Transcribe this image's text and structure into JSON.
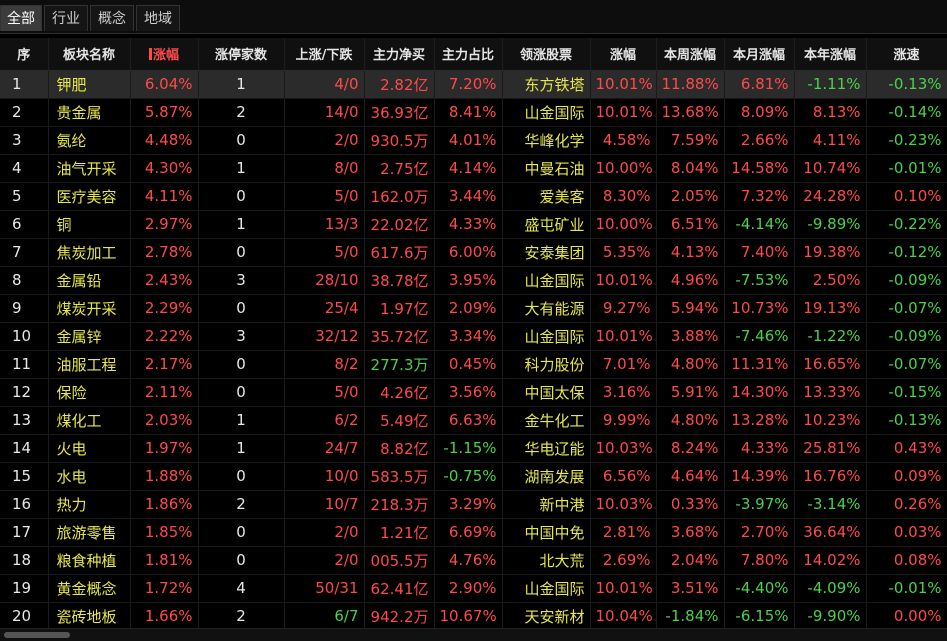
{
  "tabs": [
    {
      "label": "全部",
      "active": true
    },
    {
      "label": "行业",
      "active": false
    },
    {
      "label": "概念",
      "active": false
    },
    {
      "label": "地域",
      "active": false
    }
  ],
  "columns": {
    "index": "序",
    "name": "板块名称",
    "change": "涨幅",
    "limit_up": "涨停家数",
    "up_down": "上涨/下跌",
    "net_buy": "主力净买",
    "ratio": "主力占比",
    "leader": "领涨股票",
    "leader_change": "涨幅",
    "week_change": "本周涨幅",
    "month_change": "本月涨幅",
    "year_change": "本年涨幅",
    "speed": "涨速"
  },
  "colors": {
    "up": "#ff4a4a",
    "down": "#4ad24a",
    "name": "#e8e84a"
  },
  "rows": [
    {
      "idx": "1",
      "name": "钾肥",
      "change": "6.04%",
      "limit_up": "1",
      "up_down": "4/0",
      "net_buy": "2.82亿",
      "ratio": "7.20%",
      "leader": "东方铁塔",
      "leader_change": "10.01%",
      "week": "11.88%",
      "month": "6.81%",
      "year": "-1.11%",
      "speed": "-0.13%"
    },
    {
      "idx": "2",
      "name": "贵金属",
      "change": "5.87%",
      "limit_up": "2",
      "up_down": "14/0",
      "net_buy": "36.93亿",
      "ratio": "8.41%",
      "leader": "山金国际",
      "leader_change": "10.01%",
      "week": "13.68%",
      "month": "8.09%",
      "year": "8.13%",
      "speed": "-0.14%"
    },
    {
      "idx": "3",
      "name": "氨纶",
      "change": "4.48%",
      "limit_up": "0",
      "up_down": "2/0",
      "net_buy": "930.5万",
      "ratio": "4.01%",
      "leader": "华峰化学",
      "leader_change": "4.58%",
      "week": "7.59%",
      "month": "2.66%",
      "year": "4.11%",
      "speed": "-0.23%"
    },
    {
      "idx": "4",
      "name": "油气开采",
      "change": "4.30%",
      "limit_up": "1",
      "up_down": "8/0",
      "net_buy": "2.75亿",
      "ratio": "4.14%",
      "leader": "中曼石油",
      "leader_change": "10.00%",
      "week": "8.04%",
      "month": "14.58%",
      "year": "10.74%",
      "speed": "-0.01%"
    },
    {
      "idx": "5",
      "name": "医疗美容",
      "change": "4.11%",
      "limit_up": "0",
      "up_down": "5/0",
      "net_buy": "162.0万",
      "ratio": "3.44%",
      "leader": "爱美客",
      "leader_change": "8.30%",
      "week": "2.05%",
      "month": "7.32%",
      "year": "24.28%",
      "speed": "0.10%"
    },
    {
      "idx": "6",
      "name": "铜",
      "change": "2.97%",
      "limit_up": "1",
      "up_down": "13/3",
      "net_buy": "22.02亿",
      "ratio": "4.33%",
      "leader": "盛屯矿业",
      "leader_change": "10.00%",
      "week": "6.51%",
      "month": "-4.14%",
      "year": "-9.89%",
      "speed": "-0.22%"
    },
    {
      "idx": "7",
      "name": "焦炭加工",
      "change": "2.78%",
      "limit_up": "0",
      "up_down": "5/0",
      "net_buy": "617.6万",
      "ratio": "6.00%",
      "leader": "安泰集团",
      "leader_change": "5.35%",
      "week": "4.13%",
      "month": "7.40%",
      "year": "19.38%",
      "speed": "-0.12%"
    },
    {
      "idx": "8",
      "name": "金属铅",
      "change": "2.43%",
      "limit_up": "3",
      "up_down": "28/10",
      "net_buy": "38.78亿",
      "ratio": "3.95%",
      "leader": "山金国际",
      "leader_change": "10.01%",
      "week": "4.96%",
      "month": "-7.53%",
      "year": "2.50%",
      "speed": "-0.09%"
    },
    {
      "idx": "9",
      "name": "煤炭开采",
      "change": "2.29%",
      "limit_up": "0",
      "up_down": "25/4",
      "net_buy": "1.97亿",
      "ratio": "2.09%",
      "leader": "大有能源",
      "leader_change": "9.27%",
      "week": "5.94%",
      "month": "10.73%",
      "year": "19.13%",
      "speed": "-0.07%"
    },
    {
      "idx": "10",
      "name": "金属锌",
      "change": "2.22%",
      "limit_up": "3",
      "up_down": "32/12",
      "net_buy": "35.72亿",
      "ratio": "3.34%",
      "leader": "山金国际",
      "leader_change": "10.01%",
      "week": "3.88%",
      "month": "-7.46%",
      "year": "-1.22%",
      "speed": "-0.09%"
    },
    {
      "idx": "11",
      "name": "油服工程",
      "change": "2.17%",
      "limit_up": "0",
      "up_down": "8/2",
      "net_buy": "277.3万",
      "ratio": "0.45%",
      "leader": "科力股份",
      "leader_change": "7.01%",
      "week": "4.80%",
      "month": "11.31%",
      "year": "16.65%",
      "speed": "-0.07%"
    },
    {
      "idx": "12",
      "name": "保险",
      "change": "2.11%",
      "limit_up": "0",
      "up_down": "5/0",
      "net_buy": "4.26亿",
      "ratio": "3.56%",
      "leader": "中国太保",
      "leader_change": "3.16%",
      "week": "5.91%",
      "month": "14.30%",
      "year": "13.33%",
      "speed": "-0.15%"
    },
    {
      "idx": "13",
      "name": "煤化工",
      "change": "2.03%",
      "limit_up": "1",
      "up_down": "6/2",
      "net_buy": "5.49亿",
      "ratio": "6.63%",
      "leader": "金牛化工",
      "leader_change": "9.99%",
      "week": "4.80%",
      "month": "13.28%",
      "year": "10.23%",
      "speed": "-0.13%"
    },
    {
      "idx": "14",
      "name": "火电",
      "change": "1.97%",
      "limit_up": "1",
      "up_down": "24/7",
      "net_buy": "8.82亿",
      "ratio": "-1.15%",
      "leader": "华电辽能",
      "leader_change": "10.03%",
      "week": "8.24%",
      "month": "4.33%",
      "year": "25.81%",
      "speed": "0.43%"
    },
    {
      "idx": "15",
      "name": "水电",
      "change": "1.88%",
      "limit_up": "0",
      "up_down": "10/0",
      "net_buy": "583.5万",
      "ratio": "-0.75%",
      "leader": "湖南发展",
      "leader_change": "6.56%",
      "week": "4.64%",
      "month": "14.39%",
      "year": "16.76%",
      "speed": "0.09%"
    },
    {
      "idx": "16",
      "name": "热力",
      "change": "1.86%",
      "limit_up": "2",
      "up_down": "10/7",
      "net_buy": "218.3万",
      "ratio": "3.29%",
      "leader": "新中港",
      "leader_change": "10.03%",
      "week": "0.33%",
      "month": "-3.97%",
      "year": "-3.14%",
      "speed": "0.26%"
    },
    {
      "idx": "17",
      "name": "旅游零售",
      "change": "1.85%",
      "limit_up": "0",
      "up_down": "2/0",
      "net_buy": "1.21亿",
      "ratio": "6.69%",
      "leader": "中国中免",
      "leader_change": "2.81%",
      "week": "3.68%",
      "month": "2.70%",
      "year": "36.64%",
      "speed": "0.03%"
    },
    {
      "idx": "18",
      "name": "粮食种植",
      "change": "1.81%",
      "limit_up": "0",
      "up_down": "2/0",
      "net_buy": "005.5万",
      "ratio": "4.76%",
      "leader": "北大荒",
      "leader_change": "2.69%",
      "week": "2.04%",
      "month": "7.80%",
      "year": "14.02%",
      "speed": "0.08%"
    },
    {
      "idx": "19",
      "name": "黄金概念",
      "change": "1.72%",
      "limit_up": "4",
      "up_down": "50/31",
      "net_buy": "62.41亿",
      "ratio": "2.90%",
      "leader": "山金国际",
      "leader_change": "10.01%",
      "week": "3.51%",
      "month": "-4.40%",
      "year": "-4.09%",
      "speed": "-0.01%"
    },
    {
      "idx": "20",
      "name": "瓷砖地板",
      "change": "1.66%",
      "limit_up": "2",
      "up_down": "6/7",
      "net_buy": "942.2万",
      "ratio": "10.67%",
      "leader": "天安新材",
      "leader_change": "10.04%",
      "week": "-1.84%",
      "month": "-6.15%",
      "year": "-9.90%",
      "speed": "0.00%"
    }
  ]
}
